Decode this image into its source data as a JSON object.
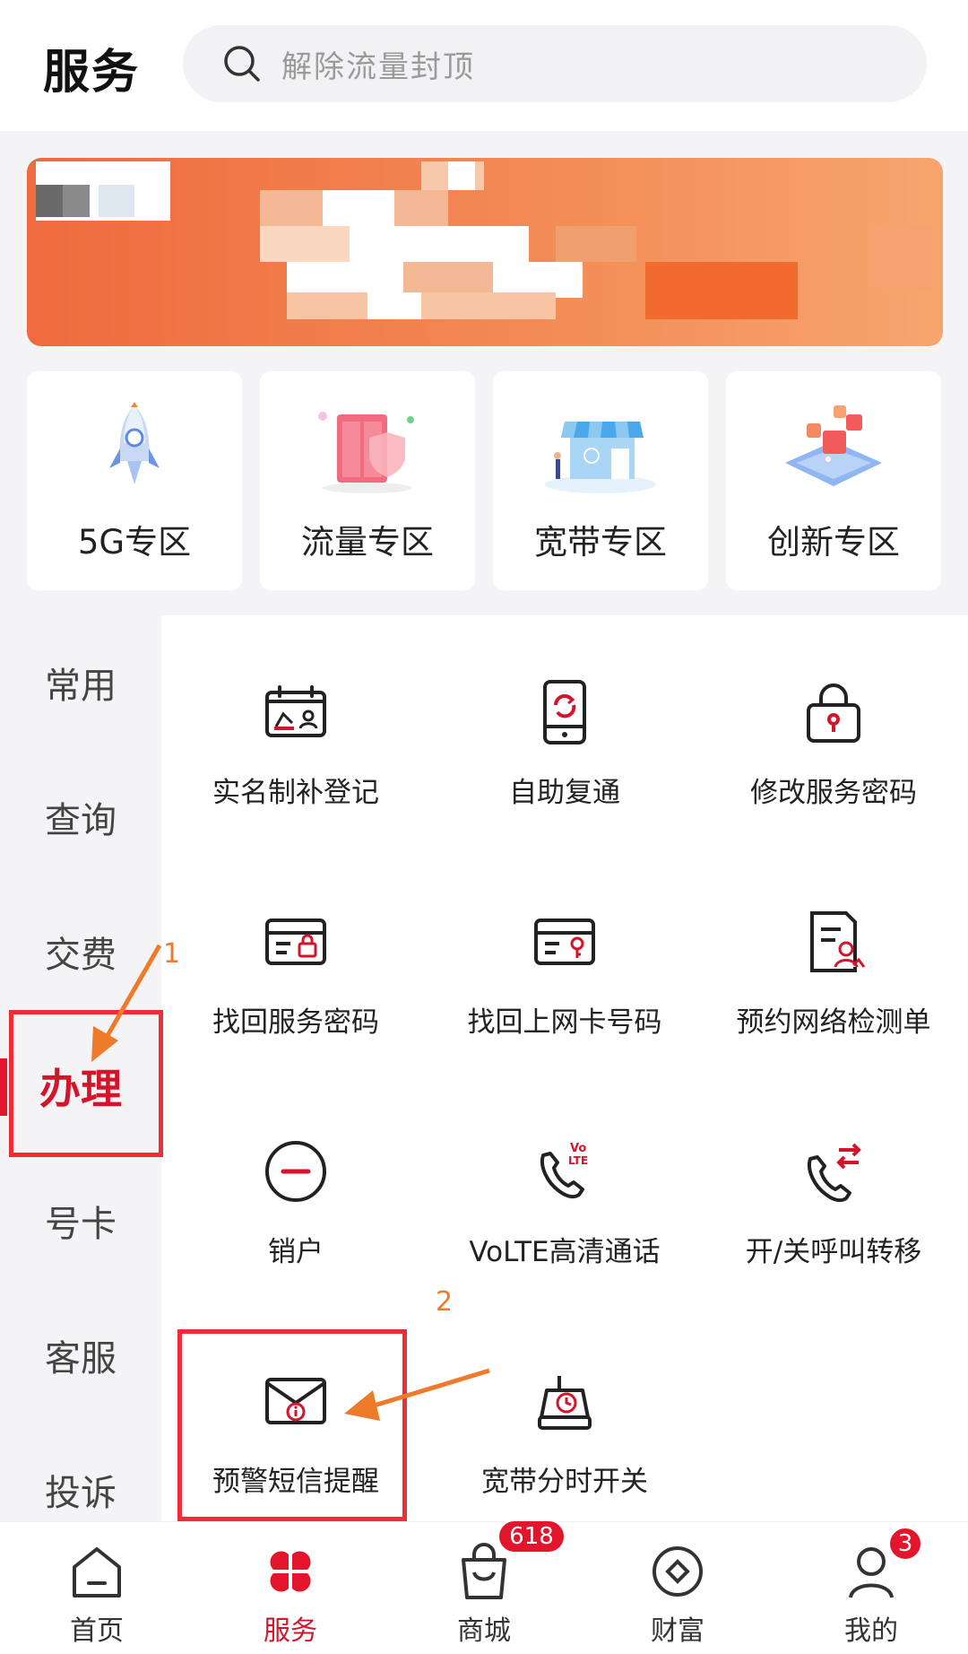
{
  "header": {
    "title": "服务",
    "search_placeholder": "解除流量封顶"
  },
  "zones": [
    {
      "label": "5G专区",
      "icon": "rocket-icon"
    },
    {
      "label": "流量专区",
      "icon": "cabinet-shield-icon"
    },
    {
      "label": "宽带专区",
      "icon": "storefront-icon"
    },
    {
      "label": "创新专区",
      "icon": "isometric-platform-icon"
    }
  ],
  "categories": [
    "常用",
    "查询",
    "交费",
    "办理",
    "号卡",
    "客服",
    "投诉"
  ],
  "active_category": "办理",
  "services": [
    {
      "label": "实名制补登记",
      "icon": "id-card-icon"
    },
    {
      "label": "自助复通",
      "icon": "phone-refresh-icon"
    },
    {
      "label": "修改服务密码",
      "icon": "lock-icon"
    },
    {
      "label": "找回服务密码",
      "icon": "card-lock-icon"
    },
    {
      "label": "找回上网卡号码",
      "icon": "card-key-icon"
    },
    {
      "label": "预约网络检测单",
      "icon": "document-user-icon"
    },
    {
      "label": "销户",
      "icon": "minus-circle-icon"
    },
    {
      "label": "VoLTE高清通话",
      "icon": "volte-phone-icon"
    },
    {
      "label": "开/关呼叫转移",
      "icon": "call-forward-icon"
    },
    {
      "label": "预警短信提醒",
      "icon": "envelope-alert-icon"
    },
    {
      "label": "宽带分时开关",
      "icon": "router-clock-icon"
    }
  ],
  "annotations": {
    "step1": "1",
    "step2": "2"
  },
  "nav": {
    "items": [
      {
        "label": "首页",
        "icon": "home-icon"
      },
      {
        "label": "服务",
        "icon": "clover-icon"
      },
      {
        "label": "商城",
        "icon": "shopping-bag-icon"
      },
      {
        "label": "财富",
        "icon": "coin-icon"
      },
      {
        "label": "我的",
        "icon": "user-icon"
      }
    ],
    "shop_badge": "618",
    "profile_badge": "3"
  },
  "colors": {
    "brand_red": "#e2152c",
    "annotation_red": "#ee2d36",
    "annotation_orange": "#ef7a2a",
    "banner_orange": "#ef6a3e"
  }
}
